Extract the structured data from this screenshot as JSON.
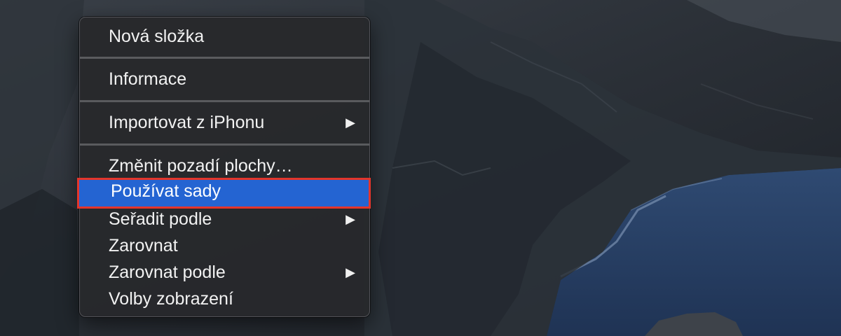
{
  "desktop": {
    "wallpaper": "coastal-cliffs-dark"
  },
  "context_menu": {
    "items": [
      {
        "label": "Nová složka"
      },
      {
        "label": "Informace"
      },
      {
        "label": "Importovat z iPhonu",
        "submenu_arrow": "▶"
      },
      {
        "label": "Změnit pozadí plochy…"
      },
      {
        "label": "Používat sady",
        "highlighted": true
      },
      {
        "label": "Seřadit podle",
        "submenu_arrow": "▶"
      },
      {
        "label": "Zarovnat"
      },
      {
        "label": "Zarovnat podle",
        "submenu_arrow": "▶"
      },
      {
        "label": "Volby zobrazení"
      }
    ]
  },
  "colors": {
    "highlight": "#2464d2",
    "annotation_border": "#e4352b",
    "menu_background": "#28292c"
  }
}
